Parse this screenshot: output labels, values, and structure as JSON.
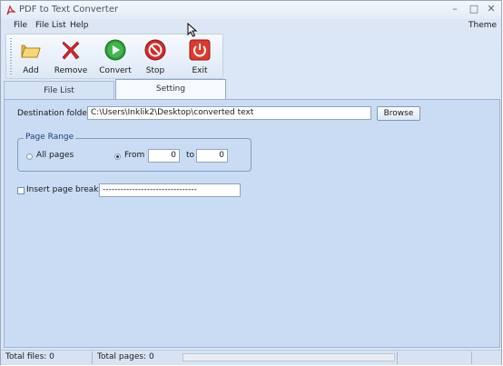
{
  "window": {
    "title": "PDF to Text Converter"
  },
  "menu": {
    "file": "File",
    "file_list": "File List",
    "help": "Help",
    "theme": "Theme"
  },
  "toolbar": {
    "add": "Add",
    "remove": "Remove",
    "convert": "Convert",
    "stop": "Stop",
    "exit": "Exit"
  },
  "tabs": [
    {
      "label": "File List",
      "active": false
    },
    {
      "label": "Setting",
      "active": true
    }
  ],
  "settings": {
    "destination_label": "Destination folder:",
    "destination_value": "C:\\Users\\Inklik2\\Desktop\\converted text",
    "browse_label": "Browse",
    "page_range_title": "Page Range",
    "all_pages_label": "All pages",
    "from_label": "From",
    "from_value": "0",
    "to_label": "to",
    "to_value": "0",
    "insert_breaks_label": "Insert page breaks:",
    "insert_breaks_value": "--------------------------------"
  },
  "status": {
    "total_files": "Total files: 0",
    "total_pages": "Total pages: 0"
  },
  "colors": {
    "accent": "#dbe7f6",
    "panel": "#c9dcf3",
    "group_title": "#1e3f7a"
  },
  "icons": {
    "app": "pdf-logo-icon",
    "add": "open-folder-icon",
    "remove": "red-x-icon",
    "convert": "green-play-icon",
    "stop": "red-stop-icon",
    "exit": "red-power-icon"
  }
}
